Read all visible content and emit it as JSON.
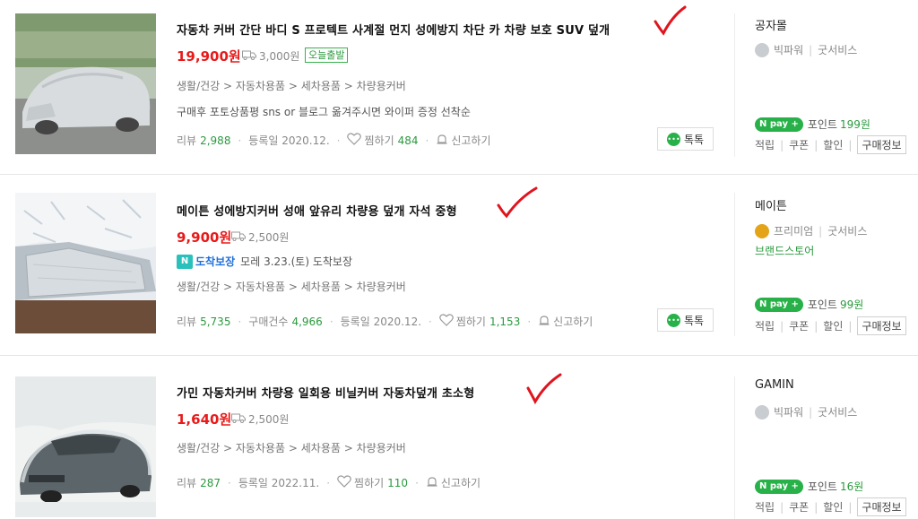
{
  "products": [
    {
      "title": "자동차 커버 간단 바디 S 프로텍트 사계절 먼지 성에방지 차단 카 차량 보호 SUV 덮개",
      "price": "19,900원",
      "shipping": "3,000원",
      "badge": "오늘출발",
      "category": "생활/건강 > 자동차용품 > 세차용품 > 차량용커버",
      "description": "구매후 포토상품평 sns or 블로그 옮겨주시면 와이퍼 증정 선착순",
      "review_label": "리뷰",
      "review_count": "2,988",
      "date": "등록일 2020.12.",
      "wish_label": "찜하기",
      "wish_count": "484",
      "report": "신고하기",
      "talk": "톡톡",
      "seller": "공자몰",
      "grade": "빅파워",
      "service": "굿서비스",
      "npay": "N pay +",
      "point_label": "포인트",
      "point": "199원",
      "links": [
        "적립",
        "쿠폰",
        "할인"
      ],
      "info": "구매정보"
    },
    {
      "title": "메이튼 성에방지커버 성애 앞유리 차량용 덮개 자석 중형",
      "price": "9,900원",
      "shipping": "2,500원",
      "delivery_badge": "도착보장",
      "delivery_text": "모레 3.23.(토) 도착보장",
      "category": "생활/건강 > 자동차용품 > 세차용품 > 차량용커버",
      "review_label": "리뷰",
      "review_count": "5,735",
      "purchase_label": "구매건수",
      "purchase_count": "4,966",
      "date": "등록일 2020.12.",
      "wish_label": "찜하기",
      "wish_count": "1,153",
      "report": "신고하기",
      "talk": "톡톡",
      "seller": "메이튼",
      "grade": "프리미엄",
      "service": "굿서비스",
      "brand": "브랜드스토어",
      "npay": "N pay +",
      "point_label": "포인트",
      "point": "99원",
      "links": [
        "적립",
        "쿠폰",
        "할인"
      ],
      "info": "구매정보"
    },
    {
      "title": "가민 자동차커버 차량용 일회용 비닐커버 자동차덮개 초소형",
      "price": "1,640원",
      "shipping": "2,500원",
      "category": "생활/건강 > 자동차용품 > 세차용품 > 차량용커버",
      "review_label": "리뷰",
      "review_count": "287",
      "date": "등록일 2022.11.",
      "wish_label": "찜하기",
      "wish_count": "110",
      "report": "신고하기",
      "seller": "GAMIN",
      "grade": "빅파워",
      "service": "굿서비스",
      "npay": "N pay +",
      "point_label": "포인트",
      "point": "16원",
      "links": [
        "적립",
        "쿠폰",
        "할인"
      ],
      "info": "구매정보"
    }
  ],
  "colors": {
    "price": "#e81a1a",
    "green": "#2b9a3e",
    "npay": "#27b148",
    "check": "#e0141e"
  },
  "icons": [
    "truck-icon",
    "heart-icon",
    "siren-icon",
    "chat-icon",
    "medal-icon",
    "checkmark-annotation"
  ]
}
